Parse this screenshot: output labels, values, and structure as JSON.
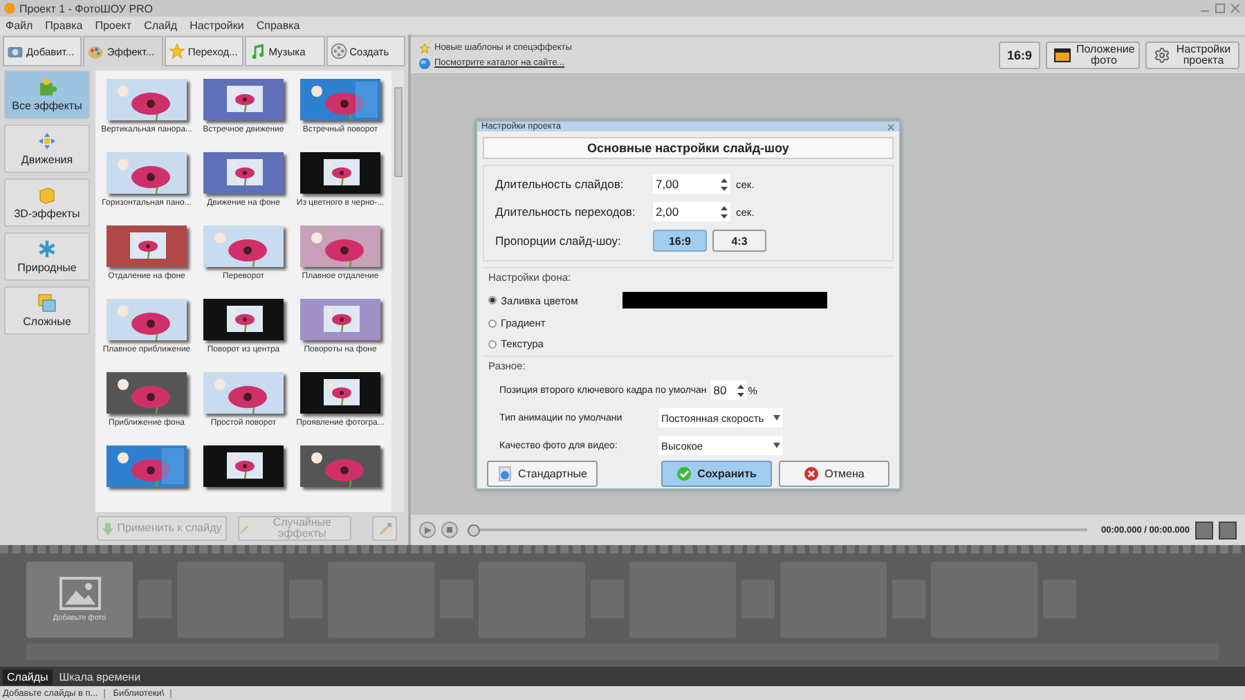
{
  "window": {
    "title": "Проект 1 - ФотоШОУ PRO"
  },
  "menu": [
    "Файл",
    "Правка",
    "Проект",
    "Слайд",
    "Настройки",
    "Справка"
  ],
  "tabs": [
    {
      "label": "Добавит...",
      "selected": false
    },
    {
      "label": "Эффект...",
      "selected": true
    },
    {
      "label": "Переход...",
      "selected": false
    },
    {
      "label": "Музыка",
      "selected": false
    },
    {
      "label": "Создать",
      "selected": false
    }
  ],
  "categories": [
    {
      "label": "Все эффекты",
      "selected": true
    },
    {
      "label": "Движения",
      "selected": false
    },
    {
      "label": "3D-эффекты",
      "selected": false
    },
    {
      "label": "Природные",
      "selected": false
    },
    {
      "label": "Сложные",
      "selected": false
    }
  ],
  "effects": [
    {
      "label": "Вертикальная панора..."
    },
    {
      "label": "Встречное движение"
    },
    {
      "label": "Встречный поворот"
    },
    {
      "label": "Горизонтальная пано..."
    },
    {
      "label": "Движение на фоне"
    },
    {
      "label": "Из цветного в черно-..."
    },
    {
      "label": "Отдаление на фоне"
    },
    {
      "label": "Переворот"
    },
    {
      "label": "Плавное отдаление"
    },
    {
      "label": "Плавное приближение"
    },
    {
      "label": "Поворот из центра"
    },
    {
      "label": "Повороты на фоне"
    },
    {
      "label": "Приближение фона"
    },
    {
      "label": "Простой поворот"
    },
    {
      "label": "Проявление фотогра..."
    },
    {
      "kind": "picture"
    },
    {
      "kind": "picture"
    },
    {
      "kind": "picture"
    }
  ],
  "effect_buttons": [
    {
      "label": "Применить к слайду",
      "kind": "apply",
      "disabled": true
    },
    {
      "label": "Случайные эффекты",
      "kind": "random",
      "disabled": true
    }
  ],
  "info": {
    "lines": [
      {
        "text": "Новые шаблоны и спецэффекты",
        "kind": "star"
      },
      {
        "text": "Посмотрите каталог на сайте...",
        "kind": "link"
      }
    ]
  },
  "toolbar": [
    {
      "label": "16:9",
      "kind": "ratio"
    },
    {
      "label": "Положение фото"
    },
    {
      "label": "Настройки проекта",
      "kind": "gear"
    }
  ],
  "player": {
    "level": 0,
    "time": "00:00.000 / 00:00.000"
  },
  "slides": {
    "add_label": "Добавьте фото"
  },
  "bottom_tabs": [
    {
      "label": "Слайды",
      "selected": true
    },
    {
      "label": "Шкала времени",
      "selected": false
    }
  ],
  "status_bar": [
    "Добавьте слайды в п...",
    "Библиотеки\\"
  ],
  "dialog": {
    "title": "Настройки проекта",
    "header": "Основные настройки слайд-шоу",
    "durations": [
      {
        "label": "Длительность слайдов:",
        "value": "7,00",
        "unit": "сек."
      },
      {
        "label": "Длительность переходов:",
        "value": "2,00",
        "unit": "сек."
      }
    ],
    "proportions": {
      "label": "Пропорции слайд-шоу:",
      "options": [
        {
          "label": "16:9",
          "selected": true
        },
        {
          "label": "4:3",
          "selected": false
        }
      ]
    },
    "background": {
      "title": "Настройки фона:",
      "color": "#000000",
      "options": [
        {
          "label": "Заливка цветом",
          "selected": true
        },
        {
          "label": "Градиент",
          "selected": false
        },
        {
          "label": "Текстура",
          "selected": false
        }
      ]
    },
    "misc": {
      "title": "Разное:",
      "rows": [
        {
          "kind": "spin",
          "label": "Позиция второго ключевого кадра по умолчан",
          "value": "80",
          "unit": "%"
        },
        {
          "kind": "select",
          "label": "Тип анимации по умолчани",
          "value": "Постоянная скорость"
        },
        {
          "kind": "select",
          "label": "Качество фото для видео:",
          "value": "Высокое"
        }
      ]
    },
    "buttons": [
      {
        "label": "Стандартные",
        "kind": "default"
      },
      {
        "label": "Сохранить",
        "kind": "primary"
      },
      {
        "label": "Отмена",
        "kind": "cancel"
      }
    ]
  }
}
